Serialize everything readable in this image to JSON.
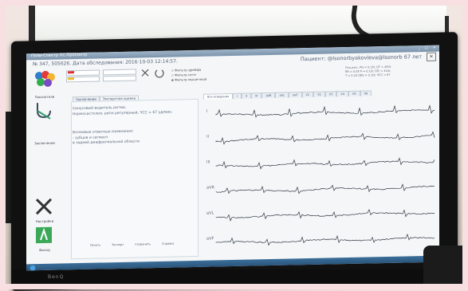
{
  "window": {
    "title": "Поли-Спектр ПС-Просмотр",
    "buttons": "_ □ ×"
  },
  "header": {
    "exam_id": "№ 347, 505626.",
    "exam_date": "Дата обследования: 2016-10-03 12:14:57.",
    "patient": "Пациент: @lsonorbyakovleva@lsonorb  67 лет",
    "close": "✕"
  },
  "controls": {
    "checkbox1": "Фильтр дрейфа",
    "checkbox2": "Фильтр сети",
    "checkbox3": "Фильтр мышечный"
  },
  "measurements": [
    "Отв.изм.:  PQ = 0.16c  QT = 400c",
    "RR = 0.85  P = 0.10c  QTc = 424c",
    "T = 0.20  QRS = 0.10c  ЧСС = 67"
  ],
  "tabs": [
    "Заключение",
    "Экспертная оценка"
  ],
  "ecg_tabs": [
    "Все отведения",
    "I",
    "II",
    "III",
    "aVR",
    "aVL",
    "aVF",
    "V1",
    "V2",
    "V3",
    "V4",
    "V5",
    "V6"
  ],
  "left_panel": {
    "item1": "Показатели",
    "item2": "Заключение",
    "item3": "Настройки",
    "item4": "Выход"
  },
  "conclusion": {
    "line1": "Синусовый водитель ритма.",
    "line2": "Нормосистолия, ритм регулярный, ЧСС = 67 уд/мин.",
    "line3": "Волновые ответные изменения:",
    "line4": "- зубцов и сегмент",
    "line5": "в задней диафрагмальной области"
  },
  "lead_labels": [
    "I",
    "II",
    "III",
    "aVR",
    "aVL",
    "aVF"
  ],
  "bottom_buttons": [
    "Печать",
    "Экспорт",
    "Сохранить",
    "Справка"
  ],
  "monitor_brand": "BenQ",
  "colors": {
    "accent": "#5b7fa6",
    "ecg_trace": "#2f3642",
    "taskbar": "#2d5b82"
  }
}
